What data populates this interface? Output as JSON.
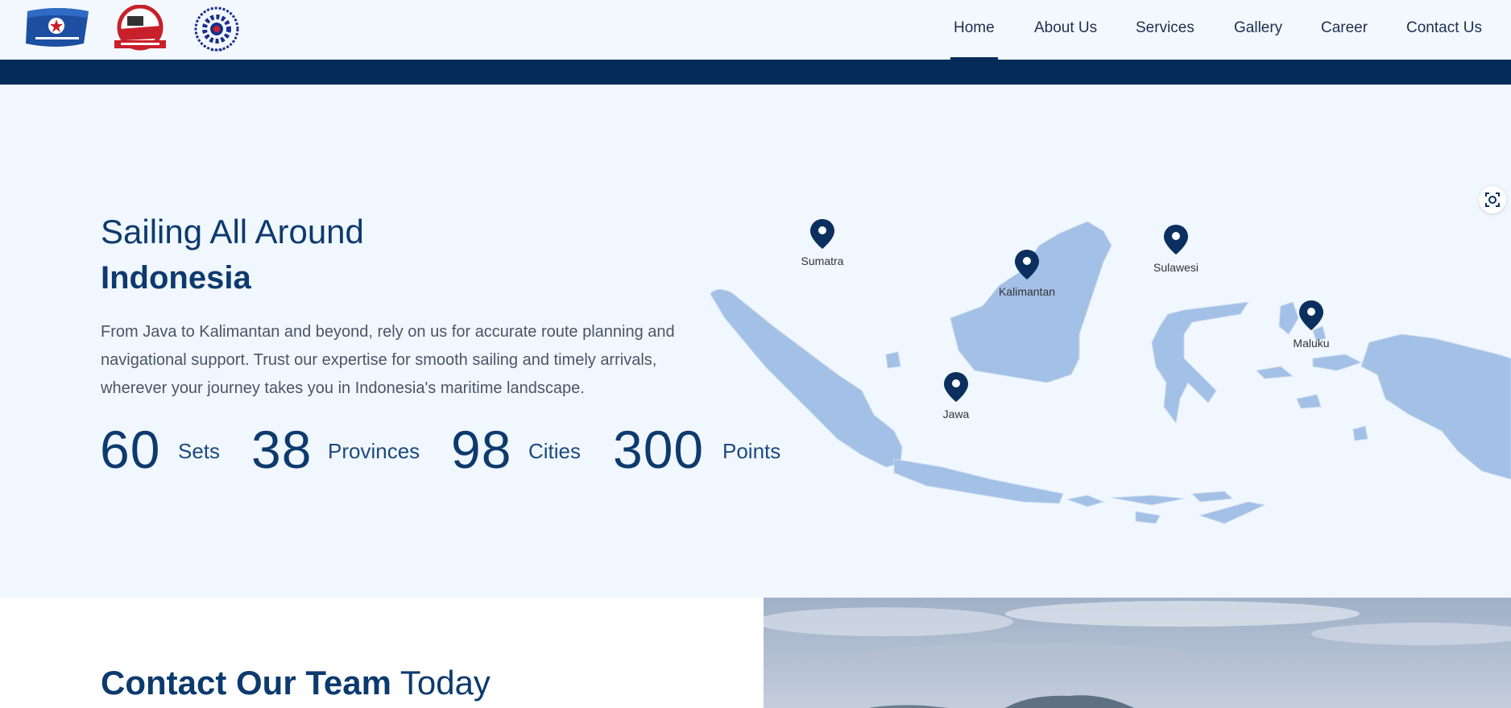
{
  "header": {
    "logos": [
      {
        "name": "company-logo-1",
        "alt": "PT. Bintang Nusantara Perkasa"
      },
      {
        "name": "company-logo-2",
        "alt": "PT. Bahari Bintang Sejahtera"
      },
      {
        "name": "company-logo-3",
        "alt": "PT Bintang Bahari Maritim"
      }
    ],
    "nav": [
      {
        "label": "Home",
        "active": true
      },
      {
        "label": "About Us"
      },
      {
        "label": "Services"
      },
      {
        "label": "Gallery"
      },
      {
        "label": "Career"
      },
      {
        "label": "Contact Us"
      }
    ]
  },
  "hero": {
    "title_line1": "Sailing All Around",
    "title_line2": "Indonesia",
    "description": "From Java to Kalimantan and beyond, rely on us for accurate route planning and navigational support. Trust our expertise for smooth sailing and timely arrivals, wherever your journey takes you in Indonesia's maritime landscape.",
    "stats": [
      {
        "value": "60",
        "label": "Sets"
      },
      {
        "value": "38",
        "label": "Provinces"
      },
      {
        "value": "98",
        "label": "Cities"
      },
      {
        "value": "300",
        "label": "Points"
      }
    ],
    "map_pins": [
      "Sumatra",
      "Kalimantan",
      "Sulawesi",
      "Jawa",
      "Maluku"
    ]
  },
  "contact": {
    "title_bold": "Contact Our Team",
    "title_light": "Today"
  },
  "colors": {
    "brand_navy": "#052c58",
    "hero_bg": "#f1f7fe",
    "map_land": "#a3c0e6",
    "pin": "#0b2f5e"
  }
}
